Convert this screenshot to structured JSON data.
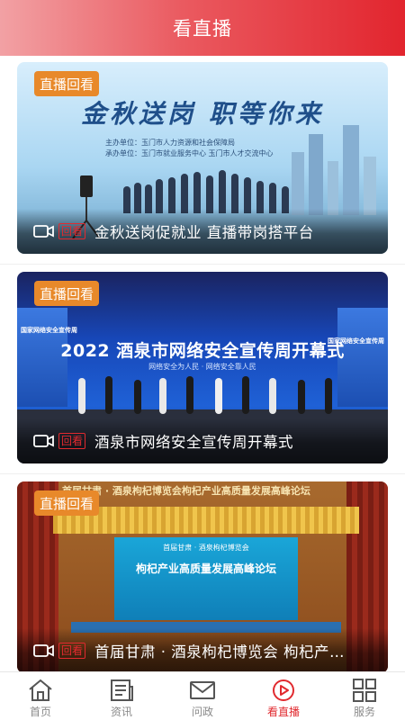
{
  "header": {
    "title": "看直播"
  },
  "badge_color": "#e8892a",
  "accent_color": "#e12a2f",
  "cards": [
    {
      "badge": "直播回看",
      "stamp": "回看",
      "title": "金秋送岗促就业  直播带岗搭平台",
      "image": {
        "banner": "金秋送岗 职等你来",
        "host": "主办单位：玉门市人力资源和社会保障局",
        "organizer": "承办单位：玉门市就业服务中心    玉门市人才交流中心"
      }
    },
    {
      "badge": "直播回看",
      "stamp": "回看",
      "title": "酒泉市网络安全宣传周开幕式",
      "image": {
        "banner": "2022 酒泉市网络安全宣传周开幕式",
        "subtitle": "网络安全为人民 · 网络安全靠人民",
        "side": "国家网络安全宣传周"
      }
    },
    {
      "badge": "直播回看",
      "stamp": "回看",
      "title": "首届甘肃 · 酒泉枸杞博览会  枸杞产业高质量发展高峰论坛",
      "image": {
        "top": "首届甘肃 · 酒泉枸杞博览会枸杞产业高质量发展高峰论坛",
        "screen_sub": "首届甘肃 · 酒泉枸杞博览会",
        "screen_title": "枸杞产业高质量发展高峰论坛"
      }
    }
  ],
  "tabs": [
    {
      "label": "首页",
      "icon": "home-icon",
      "active": false
    },
    {
      "label": "资讯",
      "icon": "news-icon",
      "active": false
    },
    {
      "label": "问政",
      "icon": "mail-icon",
      "active": false
    },
    {
      "label": "看直播",
      "icon": "live-play-icon",
      "active": true
    },
    {
      "label": "服务",
      "icon": "grid-icon",
      "active": false
    }
  ]
}
